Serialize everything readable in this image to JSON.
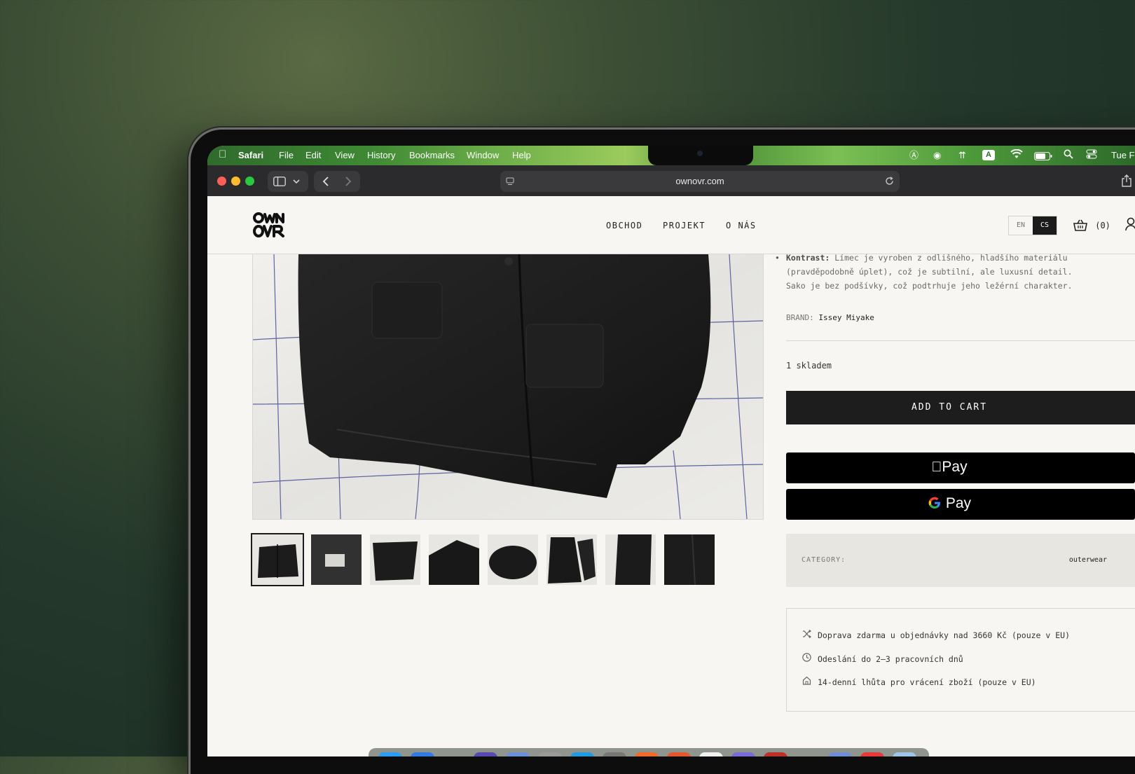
{
  "menubar": {
    "app": "Safari",
    "menus": [
      "File",
      "Edit",
      "View",
      "History",
      "Bookmarks",
      "Window",
      "Help"
    ],
    "clock": "Tue Fe"
  },
  "browser": {
    "url": "ownovr.com"
  },
  "site": {
    "logo_text": "OWN OVR",
    "nav": [
      "OBCHOD",
      "PROJEKT",
      "O NÁS"
    ],
    "lang": {
      "en": "EN",
      "cs": "CS"
    },
    "cart_count": "(0)"
  },
  "product": {
    "desc_label": "Kontrast:",
    "desc_lines": [
      "Límec je vyroben z odlišného, hladšího materiálu",
      "(pravděpodobně úplet), což je subtilní, ale luxusní detail.",
      "Sako je bez podšívky, což podtrhuje jeho ležérní charakter."
    ],
    "brand_label": "BRAND:",
    "brand_value": "Issey Miyake",
    "stock": "1 skladem",
    "add_to_cart": "ADD TO CART",
    "apple_pay": "Pay",
    "google_pay": "Pay",
    "category_label": "CATEGORY:",
    "category_value": "outerwear",
    "info": [
      "Doprava zdarma u objednávky nad 3660 Kč (pouze v EU)",
      "Odeslání do 2–3 pracovních dnů",
      "14-denní lhůta pro vrácení zboží (pouze v EU)"
    ]
  },
  "colors": {
    "page_bg": "#f7f6f2",
    "button_dark": "#1d1d1d",
    "category_bg": "#e8e6e0"
  }
}
